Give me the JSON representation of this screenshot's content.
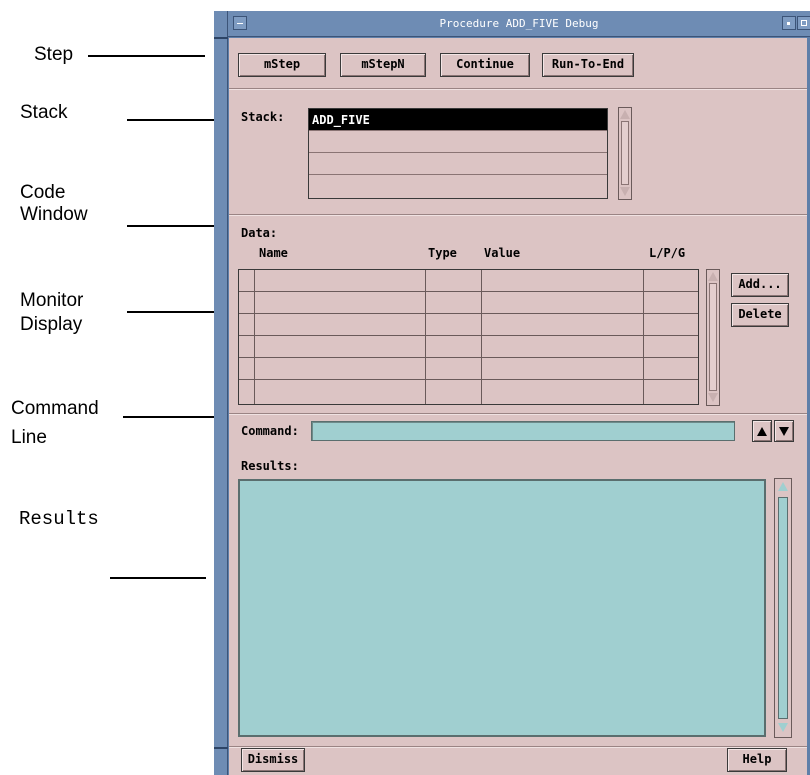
{
  "annotations": {
    "step": "Step",
    "stack": "Stack",
    "code_window_1": "Code",
    "code_window_2": "Window",
    "monitor_1": "Monitor",
    "monitor_2": "Display",
    "command_1": "Command",
    "command_2": "Line",
    "results": "Results"
  },
  "window": {
    "title": "Procedure ADD_FIVE Debug"
  },
  "toolbar": {
    "mstep": "mStep",
    "mstepn": "mStepN",
    "continue": "Continue",
    "run_to_end": "Run-To-End"
  },
  "stack": {
    "label": "Stack:",
    "items": [
      "ADD_FIVE",
      "",
      "",
      ""
    ]
  },
  "data": {
    "label": "Data:",
    "columns": [
      "Name",
      "Type",
      "Value",
      "L/P/G"
    ],
    "rows": [
      [
        "",
        "",
        "",
        ""
      ],
      [
        "",
        "",
        "",
        ""
      ],
      [
        "",
        "",
        "",
        ""
      ],
      [
        "",
        "",
        "",
        ""
      ],
      [
        "",
        "",
        "",
        ""
      ],
      [
        "",
        "",
        "",
        ""
      ]
    ],
    "add_button": "Add...",
    "delete_button": "Delete"
  },
  "command": {
    "label": "Command:",
    "value": ""
  },
  "results": {
    "label": "Results:",
    "text": ""
  },
  "footer": {
    "dismiss": "Dismiss",
    "help": "Help"
  },
  "colors": {
    "panel": "#dcc4c4",
    "field": "#a0cfd0",
    "frame": "#5f7fa9",
    "selection": "#000000"
  }
}
